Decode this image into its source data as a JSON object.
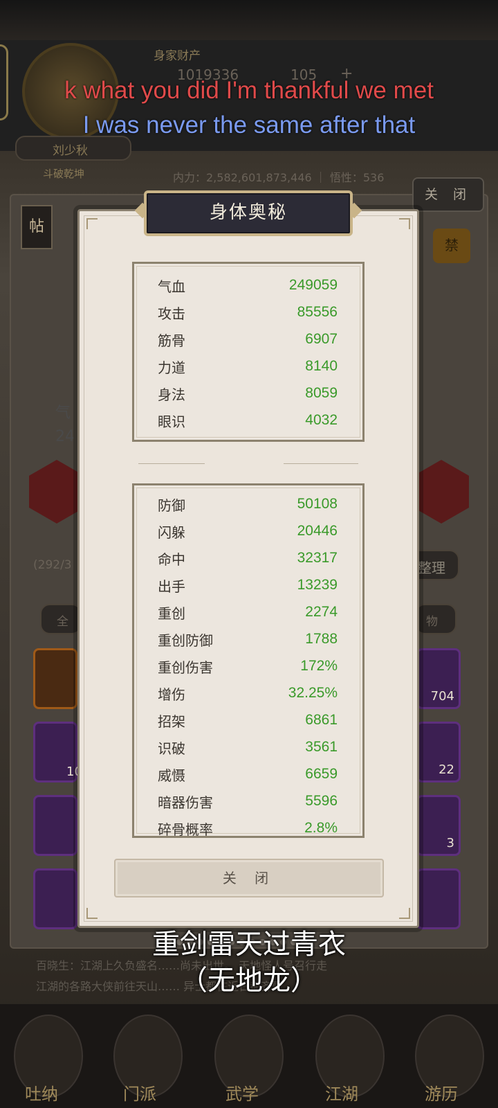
{
  "background": {
    "assets_label": "身家财产",
    "currency_1": "1019336",
    "currency_2": "105",
    "plus": "+",
    "player_name": "刘少秋",
    "player_title": "斗破乾坤",
    "power_line": "内力：2,582,601,873,446 ｜ 悟性：536",
    "close_label": "关 闭",
    "tie_label": "帖",
    "lock_label": "禁",
    "name_frag": "气",
    "val_frag": "24",
    "inventory_count": "(292/3",
    "sort_label": "整理",
    "filter_all": "全",
    "filter_item": "物",
    "slot_counts": [
      "704",
      "10",
      "22",
      "3"
    ],
    "news_lines": [
      "百晓生：江湖上久负盛名……尚未出世。 天地怪人号召行走",
      "江湖的各路大侠前往天山…… 异士都在近日都齐聚"
    ],
    "nav": [
      "吐纳",
      "门派",
      "武学",
      "江湖",
      "游历"
    ]
  },
  "subtitles": {
    "english_red": "k what you did I'm thankful we met",
    "english_blue": "I was never the same after that",
    "chinese_line1": "重剑雷天过青衣",
    "chinese_line2": "（无地龙）"
  },
  "modal": {
    "title": "身体奥秘",
    "primary_stats": [
      {
        "name": "气血",
        "value": "249059"
      },
      {
        "name": "攻击",
        "value": "85556"
      },
      {
        "name": "筋骨",
        "value": "6907"
      },
      {
        "name": "力道",
        "value": "8140"
      },
      {
        "name": "身法",
        "value": "8059"
      },
      {
        "name": "眼识",
        "value": "4032"
      }
    ],
    "secondary_stats": [
      {
        "name": "防御",
        "value": "50108"
      },
      {
        "name": "闪躲",
        "value": "20446"
      },
      {
        "name": "命中",
        "value": "32317"
      },
      {
        "name": "出手",
        "value": "13239"
      },
      {
        "name": "重创",
        "value": "2274"
      },
      {
        "name": "重创防御",
        "value": "1788"
      },
      {
        "name": "重创伤害",
        "value": "172%"
      },
      {
        "name": "增伤",
        "value": "32.25%"
      },
      {
        "name": "招架",
        "value": "6861"
      },
      {
        "name": "识破",
        "value": "3561"
      },
      {
        "name": "威慑",
        "value": "6659"
      },
      {
        "name": "暗器伤害",
        "value": "5596"
      },
      {
        "name": "碎骨概率",
        "value": "2.8%"
      }
    ],
    "close_button": "关 闭"
  },
  "colors": {
    "stat_value": "#3a9a2a",
    "title_plate": "#2c2b36",
    "title_border": "#c9b488",
    "subtitle_red": "#e04a4a",
    "subtitle_blue": "#7a9af0"
  },
  "pager": {
    "total": 14,
    "active": 0
  }
}
